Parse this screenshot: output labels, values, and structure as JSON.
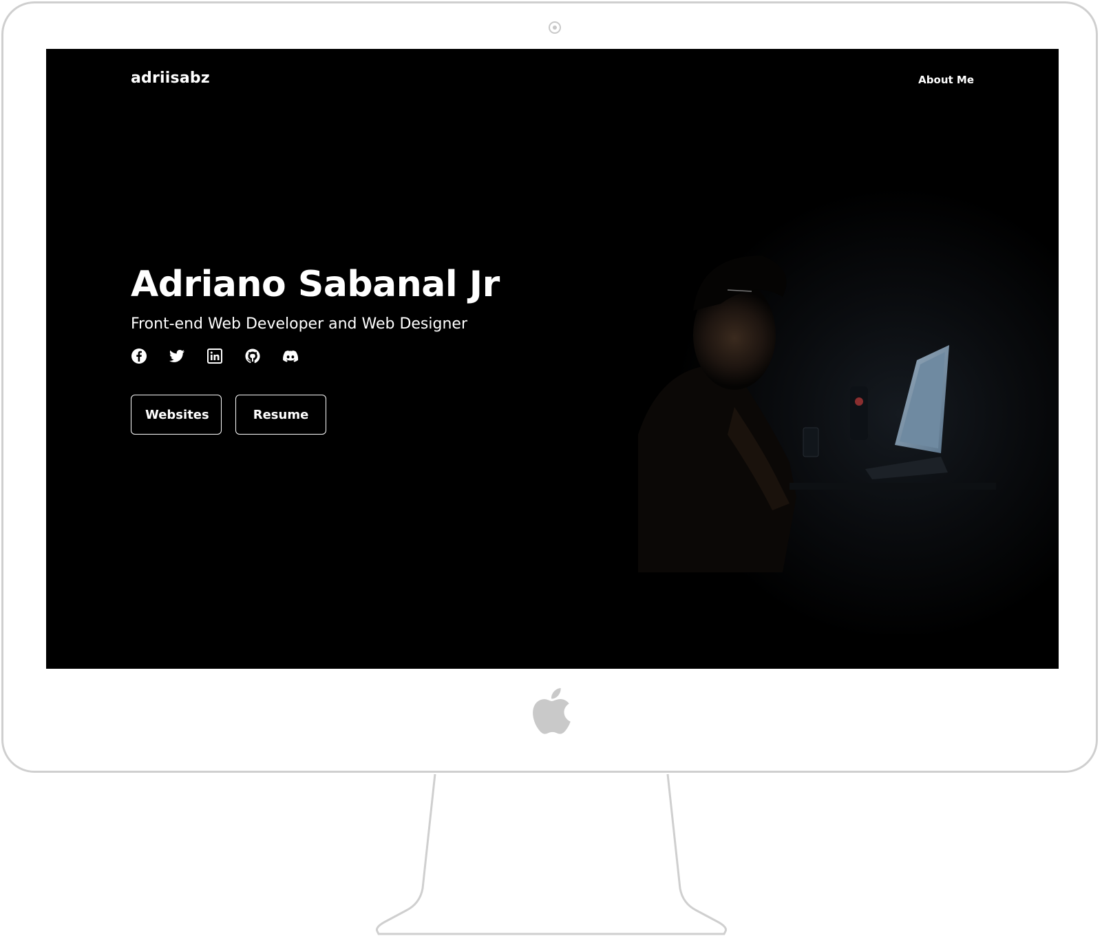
{
  "nav": {
    "brand": "adriisabz",
    "about_link": "About Me"
  },
  "hero": {
    "title": "Adriano Sabanal Jr",
    "subtitle": "Front-end Web Developer and Web Designer",
    "socials": [
      {
        "name": "facebook-icon"
      },
      {
        "name": "twitter-icon"
      },
      {
        "name": "linkedin-icon"
      },
      {
        "name": "github-icon"
      },
      {
        "name": "discord-icon"
      }
    ],
    "buttons": {
      "websites": "Websites",
      "resume": "Resume"
    }
  },
  "colors": {
    "screen_background": "#000000",
    "text": "#ffffff",
    "device_frame": "#cfcfcf"
  }
}
